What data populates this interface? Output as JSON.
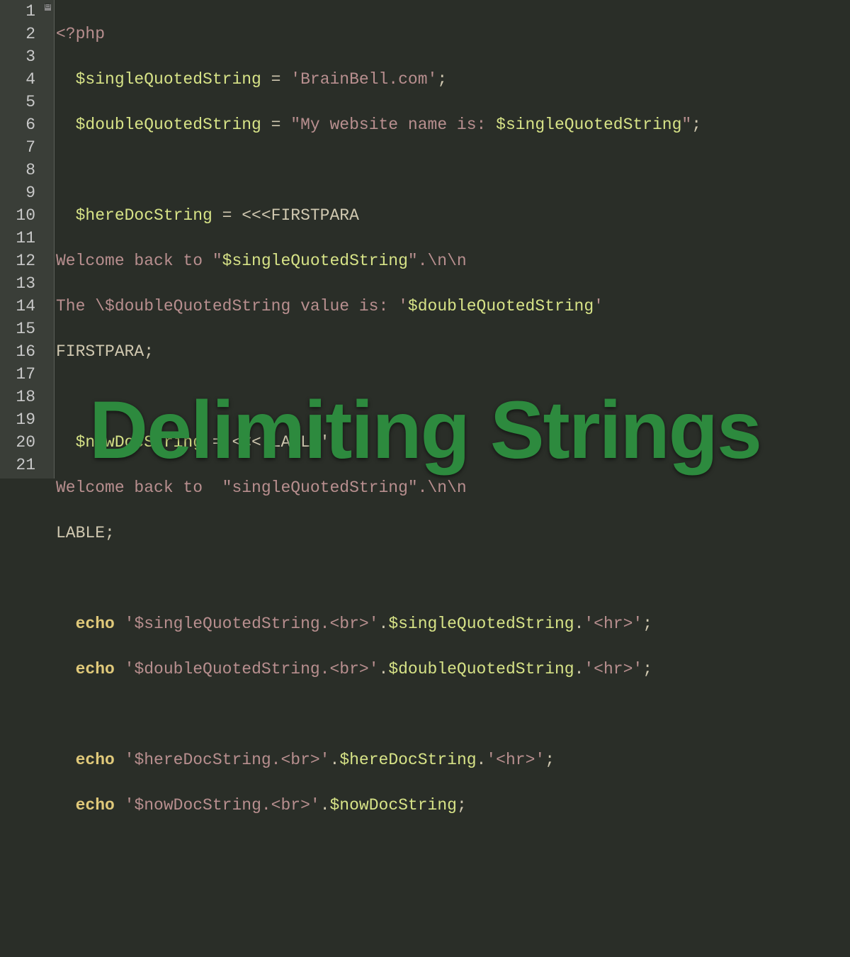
{
  "overlay_text": "Delimiting Strings",
  "line_numbers": [
    "1",
    "2",
    "3",
    "4",
    "5",
    "6",
    "7",
    "8",
    "9",
    "10",
    "11",
    "12",
    "13",
    "14",
    "15",
    "16",
    "17",
    "18",
    "19",
    "20",
    "21"
  ],
  "fold_marker": "⊟",
  "code": {
    "l1": {
      "a": "<?php"
    },
    "l2": {
      "a": "  ",
      "b": "$singleQuotedString",
      "c": " = ",
      "d": "'BrainBell.com'",
      "e": ";"
    },
    "l3": {
      "a": "  ",
      "b": "$doubleQuotedString",
      "c": " = ",
      "d": "\"My website name is: ",
      "e": "$singleQuotedString",
      "f": "\"",
      "g": ";"
    },
    "l4": {
      "a": ""
    },
    "l5": {
      "a": "  ",
      "b": "$hereDocString",
      "c": " = <<<FIRSTPARA"
    },
    "l6": {
      "a": "Welcome back to \"",
      "b": "$singleQuotedString",
      "c": "\".",
      "d": "\\n\\n"
    },
    "l7": {
      "a": "The ",
      "b": "\\$",
      "c": "doubleQuotedString value is: '",
      "d": "$doubleQuotedString",
      "e": "'"
    },
    "l8": {
      "a": "FIRSTPARA;"
    },
    "l9": {
      "a": ""
    },
    "l10": {
      "a": "  ",
      "b": "$nowDocString",
      "c": " = <<<'LABLE'"
    },
    "l11": {
      "a": "Welcome back to  \"singleQuotedString\".\\n\\n"
    },
    "l12": {
      "a": "LABLE;"
    },
    "l13": {
      "a": ""
    },
    "l14": {
      "a": "  ",
      "b": "echo",
      "c": " ",
      "d": "'$singleQuotedString.<br>'",
      "e": ".",
      "f": "$singleQuotedString",
      "g": ".",
      "h": "'<hr>'",
      "i": ";"
    },
    "l15": {
      "a": "  ",
      "b": "echo",
      "c": " ",
      "d": "'$doubleQuotedString.<br>'",
      "e": ".",
      "f": "$doubleQuotedString",
      "g": ".",
      "h": "'<hr>'",
      "i": ";"
    },
    "l16": {
      "a": ""
    },
    "l17": {
      "a": "  ",
      "b": "echo",
      "c": " ",
      "d": "'$hereDocString.<br>'",
      "e": ".",
      "f": "$hereDocString",
      "g": ".",
      "h": "'<hr>'",
      "i": ";"
    },
    "l18": {
      "a": "  ",
      "b": "echo",
      "c": " ",
      "d": "'$nowDocString.<br>'",
      "e": ".",
      "f": "$nowDocString",
      "g": ";"
    },
    "l19": {
      "a": ""
    },
    "l20": {
      "a": ""
    },
    "l21": {
      "a": ""
    }
  }
}
